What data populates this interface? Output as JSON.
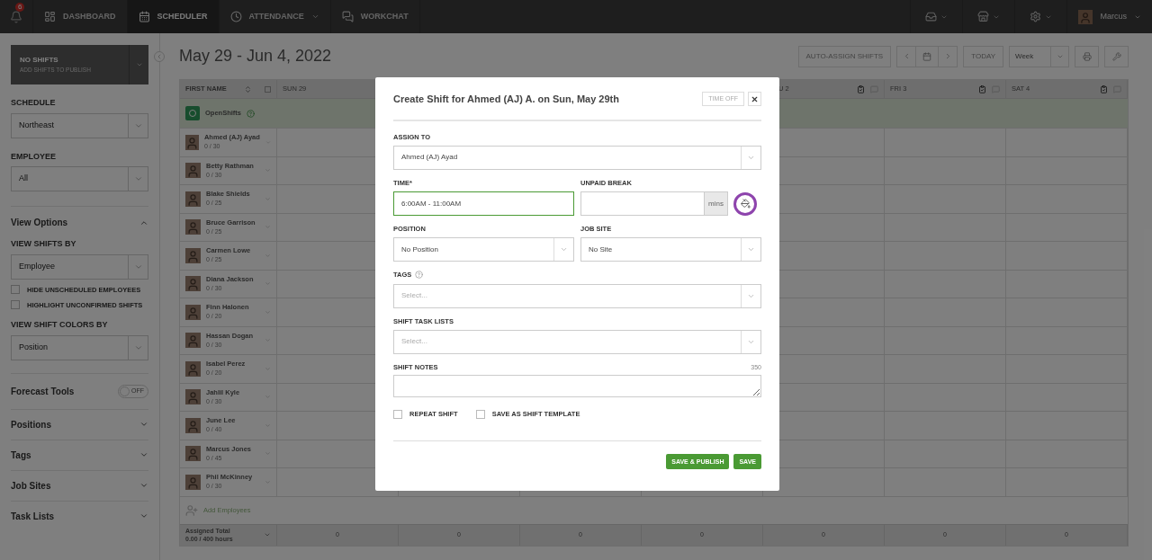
{
  "nav": {
    "notification_count": "6",
    "items": [
      {
        "label": "DASHBOARD",
        "kind": "dashboard",
        "selected": false,
        "dropdown": false
      },
      {
        "label": "SCHEDULER",
        "kind": "scheduler",
        "selected": true,
        "dropdown": false
      },
      {
        "label": "ATTENDANCE",
        "kind": "attendance",
        "selected": false,
        "dropdown": true
      },
      {
        "label": "WORKCHAT",
        "kind": "chat",
        "selected": false,
        "dropdown": false
      }
    ],
    "user": "Marcus"
  },
  "sidebar": {
    "publish": {
      "title": "NO SHIFTS",
      "subtitle": "ADD SHIFTS TO PUBLISH"
    },
    "schedule": {
      "label": "SCHEDULE",
      "value": "Northeast"
    },
    "employee": {
      "label": "EMPLOYEE",
      "value": "All"
    },
    "view_options": {
      "title": "View Options",
      "expanded": true,
      "view_shifts_by": {
        "label": "VIEW SHIFTS BY",
        "value": "Employee"
      },
      "checkboxes": [
        {
          "label": "HIDE UNSCHEDULED EMPLOYEES",
          "checked": false
        },
        {
          "label": "HIGHLIGHT UNCONFIRMED SHIFTS",
          "checked": false
        }
      ],
      "view_shift_colors_by": {
        "label": "VIEW SHIFT COLORS BY",
        "value": "Position"
      }
    },
    "forecast_tools": {
      "title": "Forecast Tools",
      "on": false,
      "toggle_text": "OFF"
    },
    "sections": [
      {
        "title": "Positions",
        "expanded": false
      },
      {
        "title": "Tags",
        "expanded": false
      },
      {
        "title": "Job Sites",
        "expanded": false
      },
      {
        "title": "Task Lists",
        "expanded": false
      }
    ]
  },
  "main": {
    "title": "May 29 - Jun 4, 2022",
    "toolbar": {
      "auto_assign": "AUTO-ASSIGN SHIFTS",
      "today": "TODAY",
      "view": "Week"
    },
    "table": {
      "first_name_header": "FIRST NAME",
      "select_all_checked": false,
      "day_columns": [
        {
          "label": "SUN 29"
        },
        {},
        {},
        {},
        {
          "label": "U 2"
        },
        {
          "label": "FRI 3"
        },
        {
          "label": "SAT 4"
        }
      ],
      "open_shifts": "OpenShifts",
      "employees": [
        {
          "name": "Ahmed (AJ) Ayad",
          "hours": "0 / 30"
        },
        {
          "name": "Betty Rathman",
          "hours": "0 / 30"
        },
        {
          "name": "Blake Shields",
          "hours": "0 / 25"
        },
        {
          "name": "Bruce Garrison",
          "hours": "0 / 25"
        },
        {
          "name": "Carmen Lowe",
          "hours": "0 / 25"
        },
        {
          "name": "Diana Jackson",
          "hours": "0 / 30"
        },
        {
          "name": "Finn Halonen",
          "hours": "0 / 20"
        },
        {
          "name": "Hassan Dogan",
          "hours": "0 / 30"
        },
        {
          "name": "Isabel Perez",
          "hours": "0 / 20"
        },
        {
          "name": "Jahlil Kyle",
          "hours": "0 / 30"
        },
        {
          "name": "June Lee",
          "hours": "0 / 40"
        },
        {
          "name": "Marcus Jones",
          "hours": "0 / 45"
        },
        {
          "name": "Phil McKinney",
          "hours": "0 / 30"
        }
      ],
      "add_employees": "Add Employees",
      "total_label": "Assigned Total",
      "total_hours": "0.00 / 400 hours",
      "totals": [
        "0",
        "0",
        "0",
        "0",
        "0",
        "0",
        "0"
      ]
    }
  },
  "modal": {
    "title": "Create Shift for Ahmed (AJ) A. on Sun, May 29th",
    "time_off": "TIME OFF",
    "assign_to": {
      "label": "ASSIGN TO",
      "value": "Ahmed (AJ) Ayad"
    },
    "time": {
      "label": "TIME*",
      "value": "6:00AM - 11:00AM"
    },
    "unpaid_break": {
      "label": "UNPAID BREAK",
      "unit": "mins"
    },
    "position": {
      "label": "POSITION",
      "value": "No Position"
    },
    "job_site": {
      "label": "JOB SITE",
      "value": "No Site"
    },
    "tags": {
      "label": "TAGS",
      "placeholder": "Select..."
    },
    "task_lists": {
      "label": "SHIFT TASK LISTS",
      "placeholder": "Select..."
    },
    "notes": {
      "label": "SHIFT NOTES",
      "count": "350"
    },
    "checkboxes": [
      {
        "label": "REPEAT SHIFT",
        "checked": false
      },
      {
        "label": "SAVE AS SHIFT TEMPLATE",
        "checked": false
      }
    ],
    "buttons": [
      {
        "label": "SAVE & PUBLISH"
      },
      {
        "label": "SAVE"
      }
    ]
  }
}
